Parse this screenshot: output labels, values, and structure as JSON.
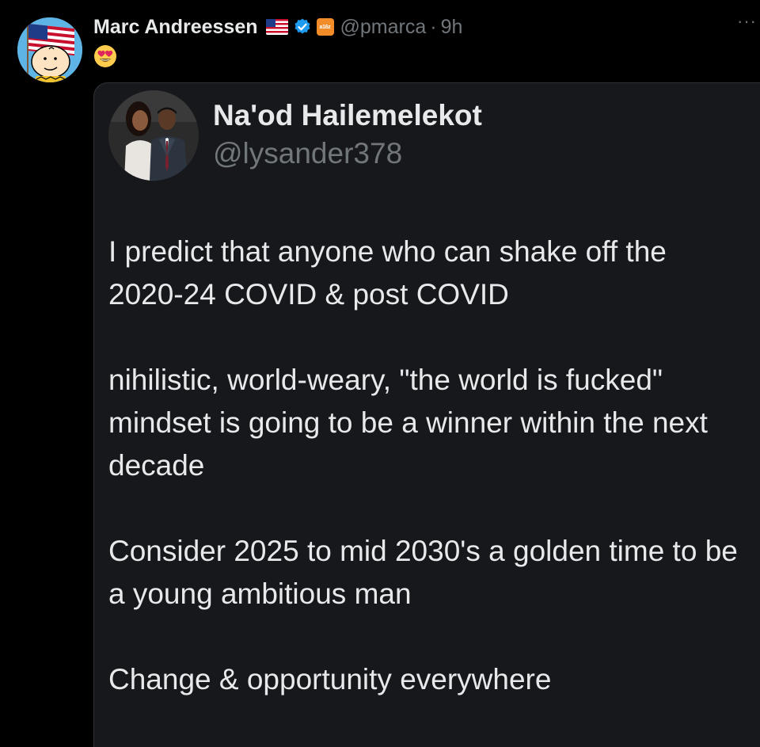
{
  "tweet": {
    "author": {
      "display_name": "Marc Andreessen",
      "handle": "@pmarca",
      "separator": "·",
      "time": "9h",
      "badges": [
        "us-flag-icon",
        "verified-icon",
        "affiliate-a16z-icon"
      ],
      "affiliate_label": "a16z"
    },
    "text_emoji": "heart-eyes-emoji",
    "more_label": "···"
  },
  "quoted_tweet": {
    "author": {
      "display_name": "Na'od Hailemelekot",
      "handle": "@lysander378"
    },
    "paragraphs": [
      "I predict that anyone who can shake off the 2020-24 COVID & post COVID",
      "nihilistic, world-weary, \"the world is fucked\" mindset is going to be a winner within the next decade",
      "Consider 2025 to mid 2030's a golden time to be a young ambitious man",
      "Change & opportunity everywhere"
    ]
  },
  "colors": {
    "background": "#000000",
    "text_primary": "#e7e9ea",
    "text_secondary": "#71767b",
    "card_background": "#16181c",
    "verified_blue": "#1d9bf0",
    "affiliate_orange": "#f28c28"
  }
}
